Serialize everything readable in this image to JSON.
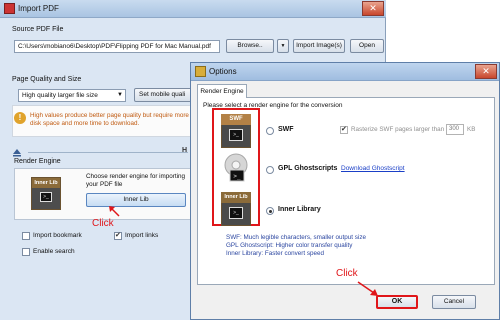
{
  "import_window": {
    "title": "Import PDF",
    "close_glyph": "✕",
    "source_label": "Source PDF File",
    "source_path": "C:\\Users\\mobiano6\\Desktop\\PDF\\Flipping PDF  for Mac Manual.pdf",
    "browse_label": "Browse..",
    "dropdown_glyph": "▼",
    "import_images_label": "Import Image(s)",
    "open_label": "Open",
    "quality_label": "Page Quality and Size",
    "quality_value": "High quality larger file size",
    "mobile_quality_label": "Set mobile quali",
    "info_icon": "!",
    "info_text": "High values produce better page quality but require more disk space and more time to download.",
    "collapse_letter": "H",
    "render_engine_label": "Render Engine",
    "render_engine_description": "Choose render engine for importing your PDF file",
    "inner_lib_badge": "Inner Lib",
    "prompt_glyph": ">_",
    "inner_lib_button": "Inner Lib",
    "click_label": "Click",
    "import_bookmark_label": "Import bookmark",
    "import_links_label": "Import links",
    "enable_search_label": "Enable search",
    "import_links_checked": true
  },
  "options_dialog": {
    "title": "Options",
    "close_glyph": "✕",
    "tab_label": "Render Engine",
    "panel_caption": "Please select a render engine for the conversion",
    "engines": [
      {
        "badge": "SWF",
        "name": "SWF",
        "selected": false
      },
      {
        "badge": "",
        "name": "GPL Ghostscripts",
        "selected": false
      },
      {
        "badge": "Inner Lib",
        "name": "Inner Library",
        "selected": true
      }
    ],
    "prompt_glyph": ">_",
    "rasterize_label": "Rasterize SWF pages larger than",
    "rasterize_value": "300",
    "rasterize_unit": "KB",
    "download_link": "Download Ghostscript",
    "descriptions": [
      "SWF: Much legible characters, smaller output size",
      "GPL Ghostscript: Higher color transfer quality",
      "Inner Library: Faster convert speed"
    ],
    "click_label": "Click",
    "ok_label": "OK",
    "cancel_label": "Cancel"
  },
  "colors": {
    "accent_red": "#e0161a",
    "link_blue": "#1a3fc7",
    "info_orange": "#c05a10"
  }
}
